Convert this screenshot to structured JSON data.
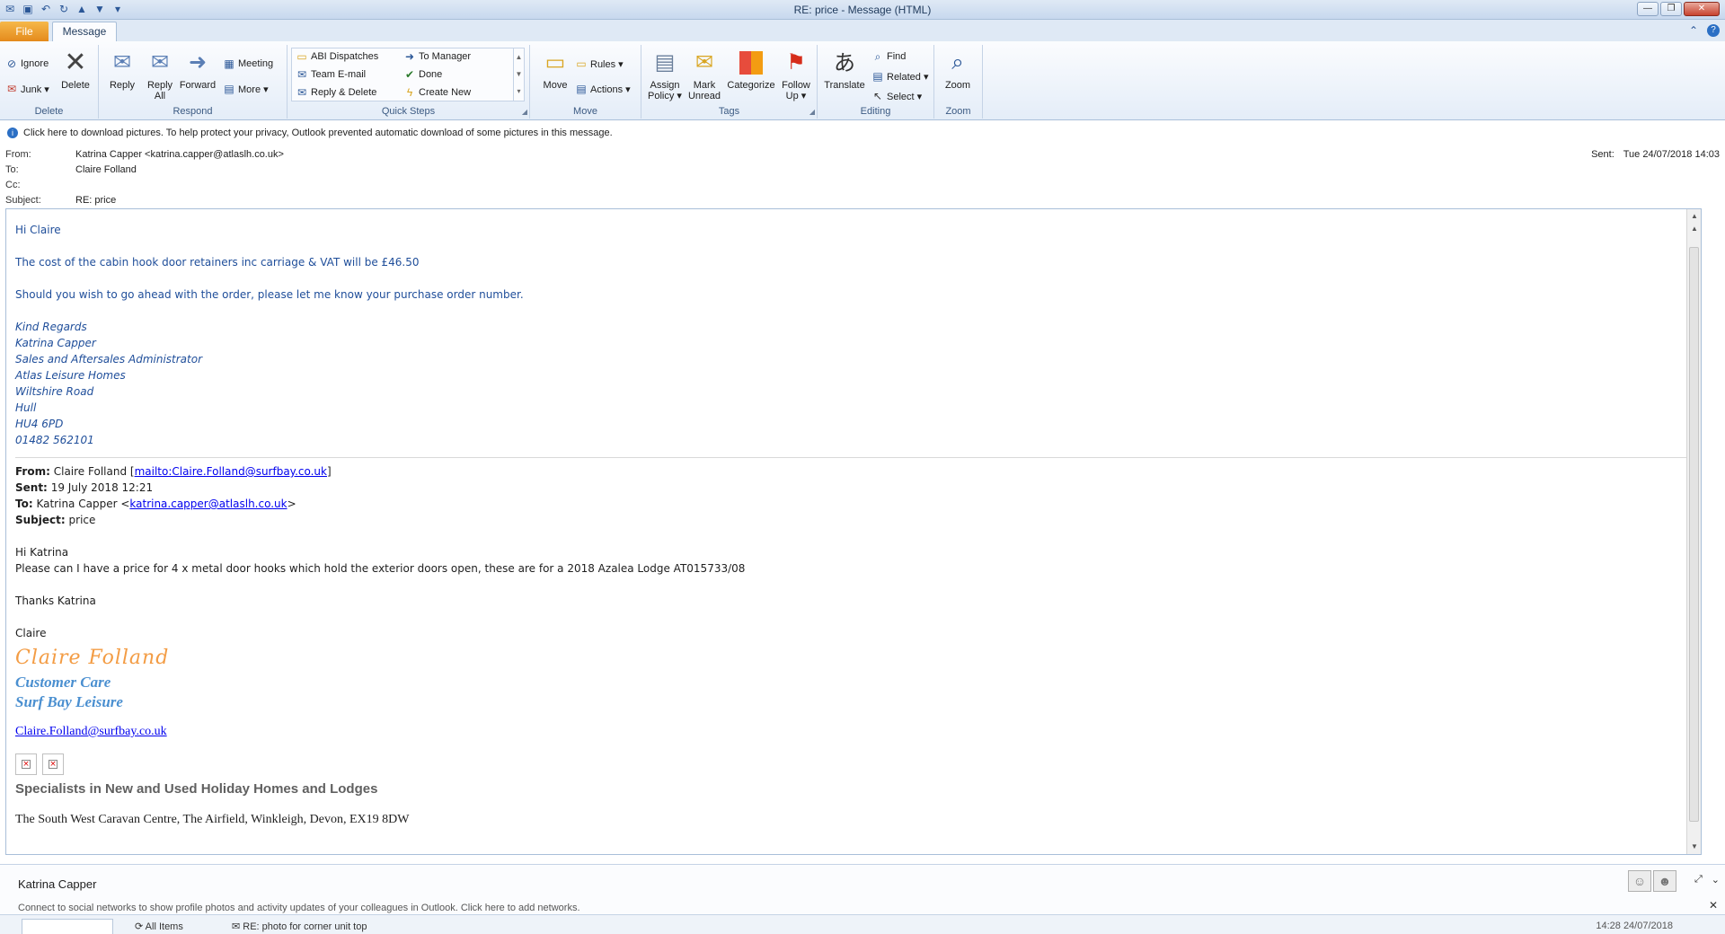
{
  "window": {
    "title": "RE: price  -  Message (HTML)",
    "controls": [
      "—",
      "❐",
      "✕"
    ]
  },
  "tabs": {
    "file": "File",
    "message": "Message"
  },
  "ribbon": {
    "delete": {
      "label": "Delete",
      "ignore": "Ignore",
      "junk": "Junk ▾",
      "delete": "Delete"
    },
    "respond": {
      "label": "Respond",
      "reply": "Reply",
      "reply_all_1": "Reply",
      "reply_all_2": "All",
      "forward": "Forward",
      "meeting": "Meeting",
      "more": "More ▾"
    },
    "quick_steps": {
      "label": "Quick Steps",
      "items": [
        "ABI Dispatches",
        "Team E-mail",
        "Reply & Delete",
        "To Manager",
        "Done",
        "Create New"
      ]
    },
    "move": {
      "label": "Move",
      "move": "Move",
      "rules": "Rules ▾",
      "actions": "Actions ▾"
    },
    "tags": {
      "label": "Tags",
      "assign_1": "Assign",
      "assign_2": "Policy ▾",
      "mark_1": "Mark",
      "mark_2": "Unread",
      "categorize": "Categorize",
      "follow_1": "Follow",
      "follow_2": "Up ▾"
    },
    "editing": {
      "label": "Editing",
      "translate": "Translate",
      "find": "Find",
      "related": "Related ▾",
      "select": "Select ▾"
    },
    "zoom": {
      "label": "Zoom",
      "zoom": "Zoom"
    }
  },
  "infobar": "Click here to download pictures. To help protect your privacy, Outlook prevented automatic download of some pictures in this message.",
  "header": {
    "from_label": "From:",
    "from": "Katrina Capper <katrina.capper@atlaslh.co.uk>",
    "to_label": "To:",
    "to": "Claire Folland",
    "cc_label": "Cc:",
    "subject_label": "Subject:",
    "subject": "RE: price",
    "sent_label": "Sent:",
    "sent": "Tue 24/07/2018 14:03"
  },
  "body": {
    "greeting": "Hi Claire",
    "line1": "The cost of the cabin hook door retainers inc carriage & VAT will be £46.50",
    "line2": "Should you wish to go ahead with the order, please let me know your purchase order number.",
    "signature": [
      "Kind Regards",
      "Katrina Capper",
      "Sales and Aftersales Administrator",
      "Atlas Leisure Homes",
      "Wiltshire Road",
      "Hull",
      "HU4 6PD",
      "01482 562101"
    ],
    "quoted": {
      "from_label": "From:",
      "from_name": "Claire Folland [",
      "from_link": "mailto:Claire.Folland@surfbay.co.uk",
      "from_end": "]",
      "sent_label": "Sent:",
      "sent": "19 July 2018 12:21",
      "to_label": "To:",
      "to_name": "Katrina Capper <",
      "to_link": "katrina.capper@atlaslh.co.uk",
      "to_end": ">",
      "subject_label": "Subject:",
      "subject": "price",
      "greeting": "Hi Katrina",
      "text": "Please can I have a price for 4 x metal door hooks which hold the exterior doors open, these are for a 2018 Azalea Lodge AT015733/08",
      "thanks": "Thanks Katrina",
      "name": "Claire",
      "sig_script": "Claire Folland",
      "sig_title1": "Customer Care",
      "sig_title2": "Surf Bay Leisure",
      "sig_email": "Claire.Folland@surfbay.co.uk",
      "specialists": "Specialists in New and Used Holiday Homes and Lodges",
      "address": "The South West Caravan Centre, The Airfield, Winkleigh, Devon, EX19 8DW"
    }
  },
  "people": {
    "name": "Katrina Capper",
    "social": "Connect to social networks to show profile photos and activity updates of your colleagues in Outlook. Click here to add networks."
  },
  "bottom": {
    "all_items": "All Items",
    "subject": "RE: photo for corner unit top",
    "time": "14:28  24/07/2018"
  }
}
